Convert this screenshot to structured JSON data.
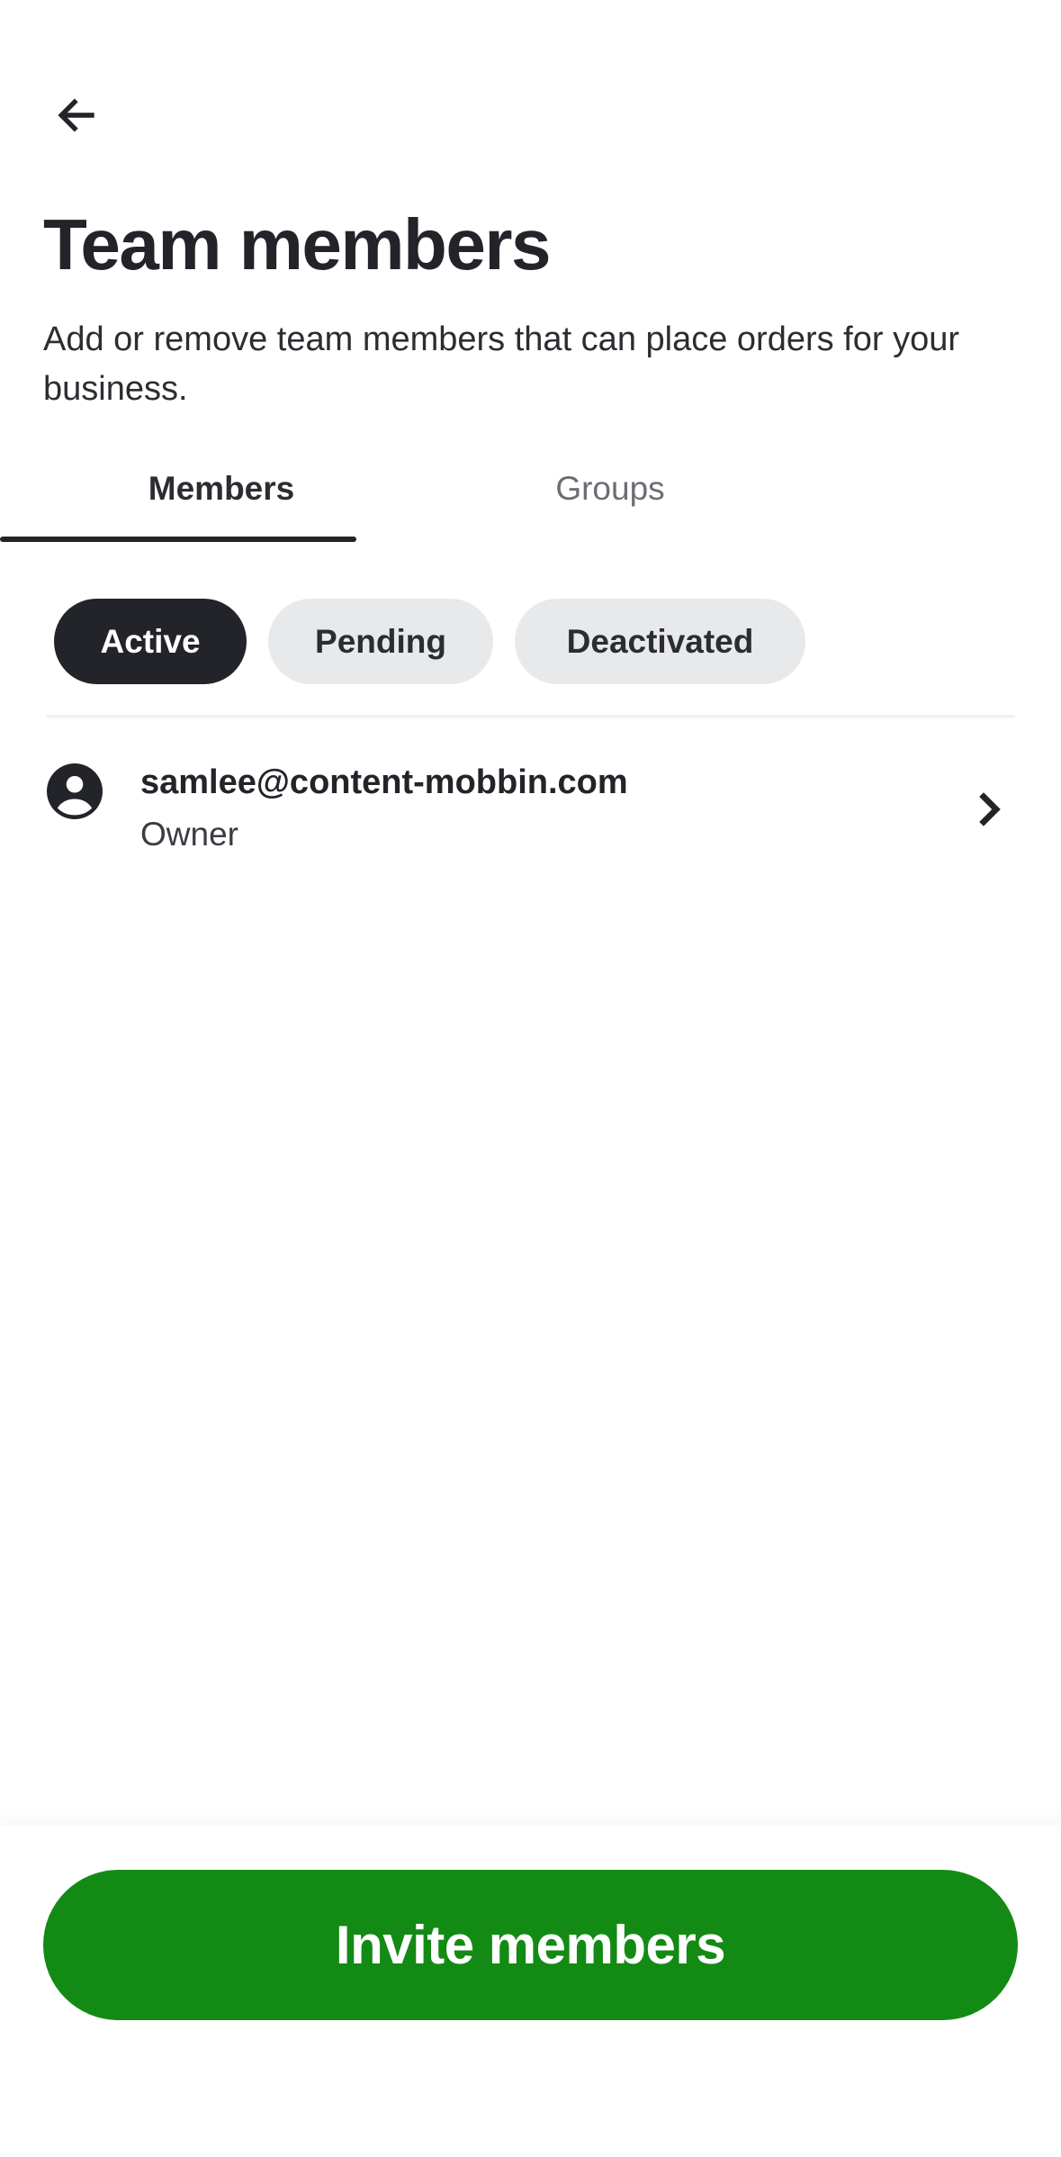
{
  "header": {
    "back_icon": "arrow-left-icon",
    "title": "Team members",
    "subtitle": "Add or remove team members that can place orders for your business."
  },
  "tabs": [
    {
      "label": "Members",
      "selected": true
    },
    {
      "label": "Groups",
      "selected": false
    }
  ],
  "filters": [
    {
      "label": "Active",
      "selected": true
    },
    {
      "label": "Pending",
      "selected": false
    },
    {
      "label": "Deactivated",
      "selected": false
    }
  ],
  "members": [
    {
      "email": "samlee@content-mobbin.com",
      "role": "Owner",
      "avatar_icon": "user-circle-icon",
      "chevron_icon": "chevron-right-icon"
    }
  ],
  "footer": {
    "invite_label": "Invite members"
  },
  "colors": {
    "primary_text": "#222429",
    "accent_green": "#138a14",
    "chip_inactive_bg": "#e8e9eb",
    "tab_inactive": "#6b6e74"
  }
}
